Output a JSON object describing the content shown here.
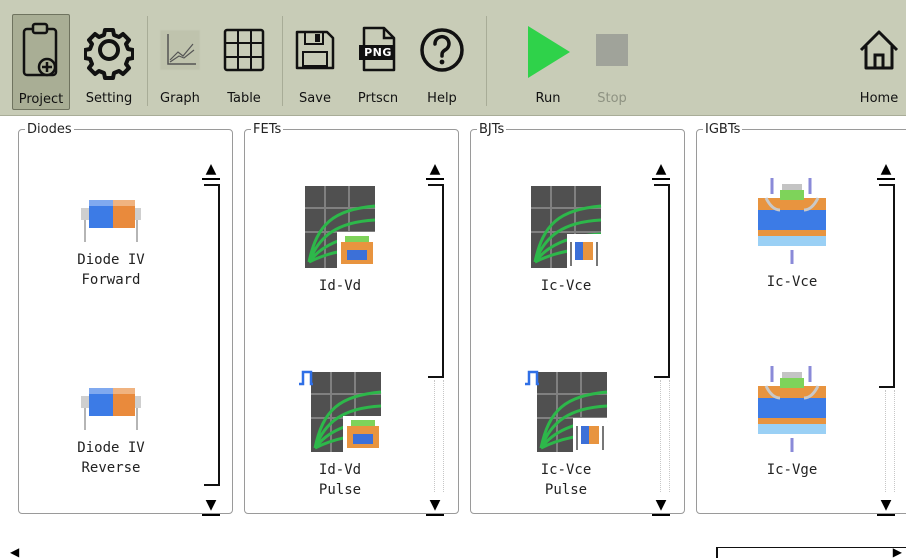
{
  "toolbar": {
    "project": "Project",
    "setting": "Setting",
    "graph": "Graph",
    "table": "Table",
    "save": "Save",
    "prtscn": "Prtscn",
    "help": "Help",
    "run": "Run",
    "stop": "Stop",
    "home": "Home",
    "png_badge": "PNG"
  },
  "groups": {
    "diodes": {
      "title": "Diodes",
      "items": [
        "Diode IV\nForward",
        "Diode IV\nReverse"
      ]
    },
    "fets": {
      "title": "FETs",
      "items": [
        "Id-Vd",
        "Id-Vd\nPulse"
      ]
    },
    "bjts": {
      "title": "BJTs",
      "items": [
        "Ic-Vce",
        "Ic-Vce\nPulse"
      ]
    },
    "igbts": {
      "title": "IGBTs",
      "items": [
        "Ic-Vce",
        "Ic-Vge"
      ]
    }
  },
  "colors": {
    "toolbar_bg": "#c8ccb7",
    "run_green": "#2fd24a",
    "stop_gray": "#a0a39a",
    "curve_green": "#2db84a",
    "pulse_blue": "#2f6fe6"
  }
}
